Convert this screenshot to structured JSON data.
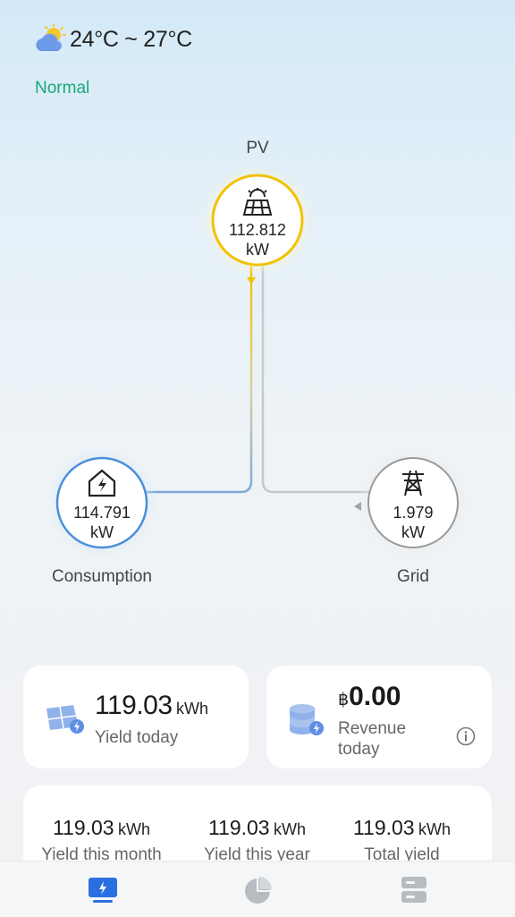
{
  "header": {
    "weather_icon": "partly-cloudy-icon",
    "temperature": "24°C ~ 27°C",
    "status": "Normal",
    "status_color": "#1aa87a"
  },
  "flow": {
    "pv": {
      "label": "PV",
      "value": "112.812",
      "unit": "kW",
      "icon": "solar-panel-icon",
      "color": "#f2c200"
    },
    "consumption": {
      "label": "Consumption",
      "value": "114.791",
      "unit": "kW",
      "icon": "house-bolt-icon",
      "color": "#4a8fdb"
    },
    "grid": {
      "label": "Grid",
      "value": "1.979",
      "unit": "kW",
      "icon": "power-tower-icon",
      "color": "#9a9a9a"
    }
  },
  "cards": {
    "yield_today": {
      "value": "119.03",
      "unit": "kWh",
      "label": "Yield today",
      "icon": "solar-panel-icon"
    },
    "revenue_today": {
      "currency": "฿",
      "value": "0.00",
      "label_line1": "Revenue",
      "label_line2": "today",
      "icon": "coins-icon",
      "info_icon": "info-icon"
    }
  },
  "stats": [
    {
      "value": "119.03",
      "unit": "kWh",
      "label": "Yield this month"
    },
    {
      "value": "119.03",
      "unit": "kWh",
      "label": "Yield this year"
    },
    {
      "value": "119.03",
      "unit": "kWh",
      "label": "Total yield"
    }
  ],
  "nav": [
    {
      "icon": "monitor-bolt-icon",
      "active": true,
      "color": "#2a6fe0"
    },
    {
      "icon": "pie-chart-icon",
      "active": false,
      "color": "#b8bcc2"
    },
    {
      "icon": "device-list-icon",
      "active": false,
      "color": "#b8bcc2"
    }
  ]
}
